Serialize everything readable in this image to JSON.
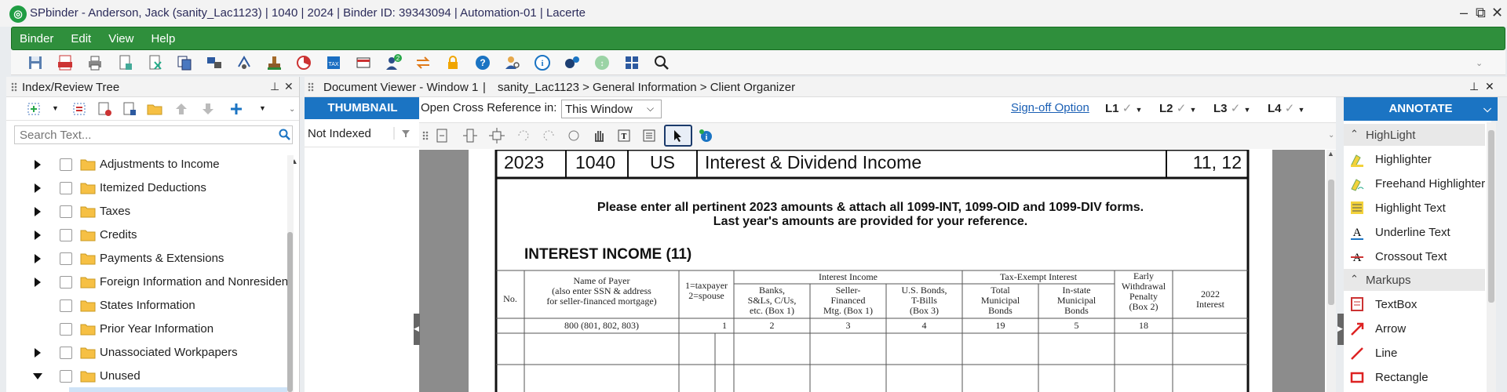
{
  "window": {
    "title": "SPbinder - Anderson, Jack (sanity_Lac1123) | 1040 | 2024 | Binder ID: 39343094 | Automation-01 | Lacerte",
    "logo_glyph": "◎",
    "controls": [
      "–",
      "⧉",
      "✕"
    ]
  },
  "menu": [
    "Binder",
    "Edit",
    "View",
    "Help"
  ],
  "toolbar": {
    "badge_count": "2",
    "icons": [
      "save-icon",
      "pdf-icon",
      "print-icon",
      "document-icon",
      "excel-icon",
      "copy-icon",
      "network-icon",
      "sync-icon",
      "stamp-icon",
      "chart-icon",
      "tax-icon",
      "card-icon",
      "users-icon",
      "transfer-icon",
      "lock-icon",
      "help-icon",
      "person-search-icon",
      "info-icon",
      "settings-icon",
      "link-icon",
      "grid-icon",
      "search-icon"
    ]
  },
  "left_pane": {
    "title": "Index/Review Tree",
    "search_placeholder": "Search Text...",
    "items": [
      {
        "label": "Adjustments to Income",
        "expand": "right"
      },
      {
        "label": "Itemized Deductions",
        "expand": "right"
      },
      {
        "label": "Taxes",
        "expand": "right"
      },
      {
        "label": "Credits",
        "expand": "right"
      },
      {
        "label": "Payments & Extensions",
        "expand": "right"
      },
      {
        "label": "Foreign Information and Nonresident",
        "expand": "right"
      },
      {
        "label": "States Information",
        "expand": "none"
      },
      {
        "label": "Prior Year Information",
        "expand": "none"
      },
      {
        "label": "Unassociated Workpapers",
        "expand": "right"
      },
      {
        "label": "Unused",
        "expand": "down"
      }
    ]
  },
  "viewer": {
    "title": "Document Viewer - Window 1",
    "breadcrumb": "sanity_Lac1123 > General Information > Client Organizer",
    "thumbnail_label": "THUMBNAIL",
    "index_filter": "Not Indexed",
    "crossref_label": "Open Cross Reference in:",
    "crossref_value": "This Window",
    "signoff_link": "Sign-off Option",
    "levels": [
      "L1",
      "L2",
      "L3",
      "L4"
    ],
    "checkmark": "✓"
  },
  "document": {
    "header": {
      "year": "2023",
      "form": "1040",
      "jurisdiction": "US",
      "title": "Interest & Dividend Income",
      "pages": "11, 12"
    },
    "instructions_line1": "Please enter all pertinent 2023 amounts & attach all 1099-INT, 1099-OID and 1099-DIV forms.",
    "instructions_line2": "Last year's amounts are provided for your reference.",
    "section_title": "INTEREST INCOME (11)",
    "table": {
      "col_no": "No.",
      "col_payer": "Name of Payer\n(also enter SSN & address\nfor seller-financed mortgage)",
      "col_taxpayer": "1=taxpayer\n2=spouse",
      "group_interest": "Interest Income",
      "group_exempt": "Tax-Exempt Interest",
      "col_banks": "Banks,\nS&Ls, C/Us,\netc. (Box 1)",
      "col_seller": "Seller-\nFinanced\nMtg. (Box 1)",
      "col_usbonds": "U.S. Bonds,\nT-Bills\n(Box 3)",
      "col_total_muni": "Total\nMunicipal\nBonds",
      "col_instate_muni": "In-state\nMunicipal\nBonds",
      "col_early": "Early\nWithdrawal\nPenalty\n(Box 2)",
      "col_prior": "2022\nInterest",
      "codes": {
        "payer": "800 (801, 802, 803)",
        "taxpayer": "1",
        "banks": "2",
        "seller": "3",
        "usbonds": "4",
        "total_muni": "19",
        "instate_muni": "5",
        "early": "18"
      }
    }
  },
  "annotate": {
    "title": "ANNOTATE",
    "groups": [
      {
        "name": "HighLight",
        "items": [
          "Highlighter",
          "Freehand Highlighter",
          "Highlight Text",
          "Underline Text",
          "Crossout Text"
        ]
      },
      {
        "name": "Markups",
        "items": [
          "TextBox",
          "Arrow",
          "Line",
          "Rectangle"
        ]
      }
    ]
  },
  "colors": {
    "menu_green": "#2f8f3c",
    "thumbnail_blue": "#1b74c3",
    "link_blue": "#1a5fb4"
  }
}
